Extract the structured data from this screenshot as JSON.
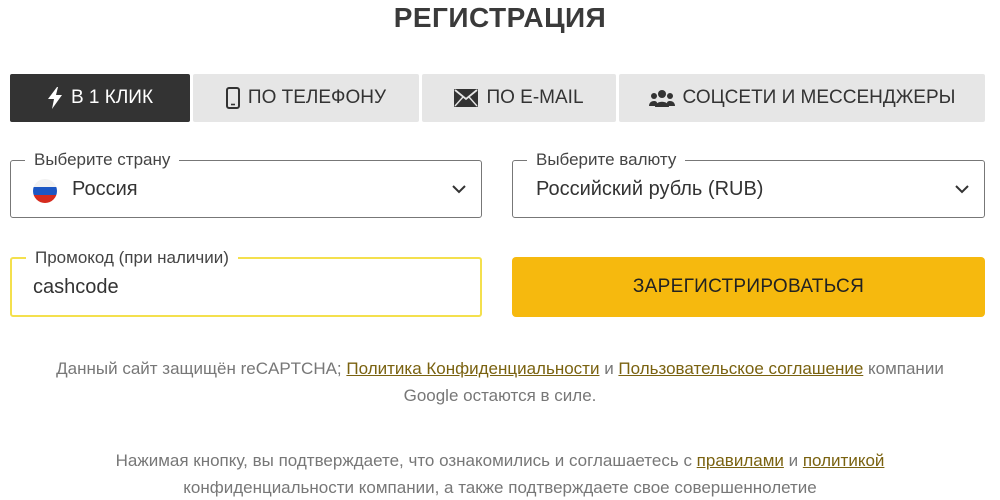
{
  "header": {
    "title": "РЕГИСТРАЦИЯ"
  },
  "tabs": [
    {
      "label": "В 1 КЛИК",
      "icon": "lightning-icon",
      "active": true
    },
    {
      "label": "ПО ТЕЛЕФОНУ",
      "icon": "phone-icon",
      "active": false
    },
    {
      "label": "ПО E-MAIL",
      "icon": "envelope-icon",
      "active": false
    },
    {
      "label": "СОЦСЕТИ И МЕССЕНДЖЕРЫ",
      "icon": "users-icon",
      "active": false
    }
  ],
  "form": {
    "country": {
      "label": "Выберите страну",
      "value": "Россия",
      "flag_icon": "russia-flag-icon"
    },
    "currency": {
      "label": "Выберите валюту",
      "value": "Российский рубль (RUB)"
    },
    "promo": {
      "label": "Промокод (при наличии)",
      "value": "cashcode"
    },
    "submit_label": "ЗАРЕГИСТРИРОВАТЬСЯ"
  },
  "recaptcha_note": {
    "part1": "Данный сайт защищён reCAPTCHA; ",
    "privacy_link": "Политика Конфиденциальности",
    "and1": " и ",
    "terms_link": "Пользовательское соглашение",
    "part2": " компании",
    "line2": "Google остаются в силе."
  },
  "consent_note": {
    "part1": "Нажимая кнопку, вы подтверждаете, что ознакомились и соглашаетесь с ",
    "rules_link": "правилами",
    "and1": " и ",
    "policy_link": "политикой",
    "line2": "конфиденциальности компании, а также подтверждаете свое совершеннолетие"
  },
  "colors": {
    "accent": "#f6b90e",
    "active_tab": "#333333",
    "inactive_tab": "#e6e6e6",
    "promo_border": "#f4e04d",
    "link": "#7a6210"
  }
}
